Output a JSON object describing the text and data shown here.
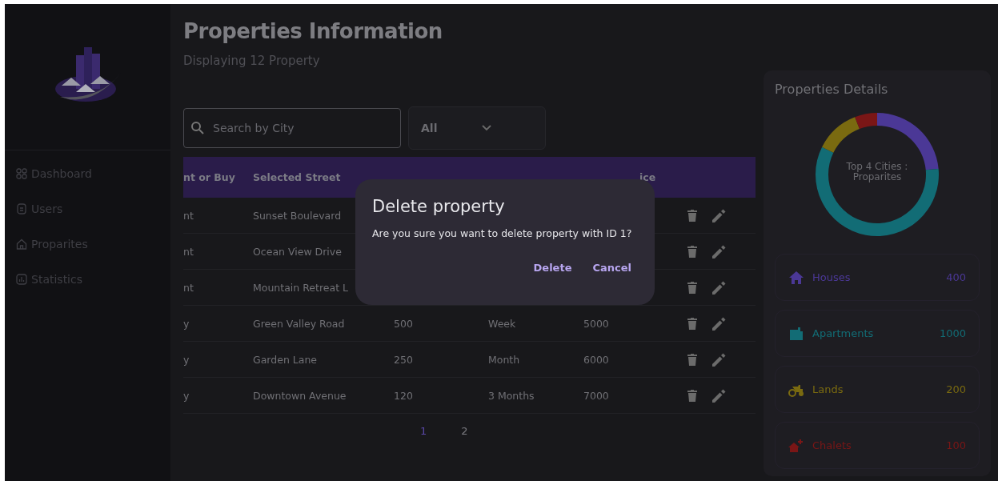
{
  "sidebar": {
    "items": [
      {
        "label": "Dashboard",
        "kind": "grid"
      },
      {
        "label": "Users",
        "kind": "user"
      },
      {
        "label": "Proparites",
        "kind": "home"
      },
      {
        "label": "Statistics",
        "kind": "chart"
      }
    ]
  },
  "header": {
    "title": "Properties Information",
    "subtitle": "Displaying 12 Property"
  },
  "search": {
    "placeholder": "Search by City"
  },
  "filter": {
    "value": "All"
  },
  "table": {
    "columns": [
      "nt or Buy",
      "Selected Street",
      "",
      "",
      "ice"
    ],
    "rows": [
      {
        "cells": [
          "nt",
          "Sunset Boulevard",
          "",
          "",
          ""
        ]
      },
      {
        "cells": [
          "nt",
          "Ocean View Drive",
          "",
          "",
          ""
        ]
      },
      {
        "cells": [
          "nt",
          "Mountain Retreat L",
          "",
          "",
          ""
        ]
      },
      {
        "cells": [
          "y",
          "Green Valley Road",
          "500",
          "Week",
          "5000"
        ]
      },
      {
        "cells": [
          "y",
          "Garden Lane",
          "250",
          "Month",
          "6000"
        ]
      },
      {
        "cells": [
          "y",
          "Downtown Avenue",
          "120",
          "3 Months",
          "7000"
        ]
      }
    ]
  },
  "pagination": [
    {
      "label": "1",
      "selected": true
    },
    {
      "label": "2",
      "selected": false
    }
  ],
  "dialog": {
    "title": "Delete property",
    "message": "Are you sure you want to delete property with ID 1?",
    "buttons": [
      "Delete",
      "Cancel"
    ]
  },
  "details": {
    "title": "Properties Details",
    "chart_label": "Top 4 Cities : Proparites",
    "items": [
      {
        "label": "Houses",
        "count": "400",
        "kind": "house",
        "color": "#4b3896"
      },
      {
        "label": "Apartments",
        "count": "1000",
        "kind": "building",
        "color": "#126c75"
      },
      {
        "label": "Lands",
        "count": "200",
        "kind": "tractor",
        "color": "#7a6a10"
      },
      {
        "label": "Chalets",
        "count": "100",
        "kind": "chalet",
        "color": "#7a1616"
      }
    ]
  }
}
